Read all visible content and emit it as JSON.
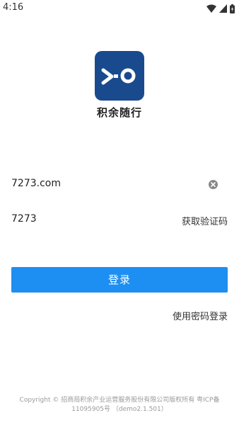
{
  "status_bar": {
    "time": "4:16",
    "icons": [
      "wifi-icon",
      "cellular-signal-icon",
      "battery-charging-icon"
    ]
  },
  "app": {
    "name": "积余随行",
    "logo_icon": "app-logo-icon",
    "brand_color": "#1a4a8e"
  },
  "form": {
    "account_value": "7273.com",
    "code_value": "7273",
    "get_code_label": "获取验证码",
    "clear_icon": "clear-icon"
  },
  "login": {
    "button_label": "登录",
    "button_color": "#1d8ff2",
    "password_login_label": "使用密码登录"
  },
  "footer": {
    "line1": "Copyright © 招商局积余产业运营服务股份有限公司版权所有 粤ICP备",
    "line2": "11095905号 （demo2.1.501）"
  }
}
